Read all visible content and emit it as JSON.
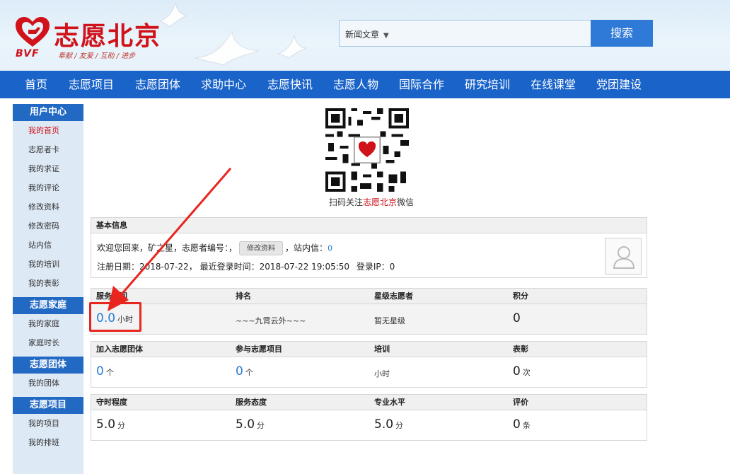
{
  "header": {
    "logo_title": "志愿北京",
    "logo_abbr": "BVF",
    "logo_slogan": "奉献 / 友爱 / 互助 / 进步",
    "search_select": "新闻文章",
    "search_button": "搜索"
  },
  "nav": [
    "首页",
    "志愿项目",
    "志愿团体",
    "求助中心",
    "志愿快讯",
    "志愿人物",
    "国际合作",
    "研究培训",
    "在线课堂",
    "党团建设"
  ],
  "sidebar": {
    "sections": [
      {
        "title": "用户中心",
        "items": [
          "我的首页",
          "志愿者卡",
          "我的求证",
          "我的评论",
          "修改资料",
          "修改密码",
          "站内信",
          "我的培训",
          "我的表彰"
        ]
      },
      {
        "title": "志愿家庭",
        "items": [
          "我的家庭",
          "家庭时长"
        ]
      },
      {
        "title": "志愿团体",
        "items": [
          "我的团体"
        ]
      },
      {
        "title": "志愿项目",
        "items": [
          "我的项目",
          "我的排班"
        ]
      }
    ]
  },
  "qr": {
    "caption_pre": "扫码关注",
    "caption_red": "志愿北京",
    "caption_post": "微信"
  },
  "basic_info": {
    "title": "基本信息",
    "welcome": "欢迎您回来，",
    "name": "矿",
    "name_rest": "之星，志愿者编号：，",
    "edit_button": "修改资料",
    "msg_label": "，站内信：",
    "msg_count": "0",
    "reg_label": "注册日期：",
    "reg_date": "2018-07-22，",
    "last_login_label": "最近登录时间：",
    "last_login": "2018-07-22 19:05:50",
    "ip_label": "登录IP：",
    "ip": "0"
  },
  "stats1": {
    "headers": [
      "服务时间",
      "排名",
      "星级志愿者",
      "积分"
    ],
    "service_hours": "0.0",
    "service_unit": "小时",
    "rank": "~~~九霄云外~~~",
    "star": "暂无星级",
    "points": "0"
  },
  "stats2": {
    "headers": [
      "加入志愿团体",
      "参与志愿项目",
      "培训",
      "表彰"
    ],
    "groups": "0",
    "groups_unit": "个",
    "projects": "0",
    "projects_unit": "个",
    "training_unit": "小时",
    "honors": "0",
    "honors_unit": "次"
  },
  "stats3": {
    "headers": [
      "守时程度",
      "服务态度",
      "专业水平",
      "评价"
    ],
    "punctual": "5.0",
    "attitude": "5.0",
    "skill": "5.0",
    "score_unit": "分",
    "reviews": "0",
    "reviews_unit": "条"
  },
  "colors": {
    "brand_red": "#d0121b",
    "nav_blue": "#1a63c9",
    "accent_blue": "#2a7ad6",
    "highlight_red": "#e8251f"
  }
}
